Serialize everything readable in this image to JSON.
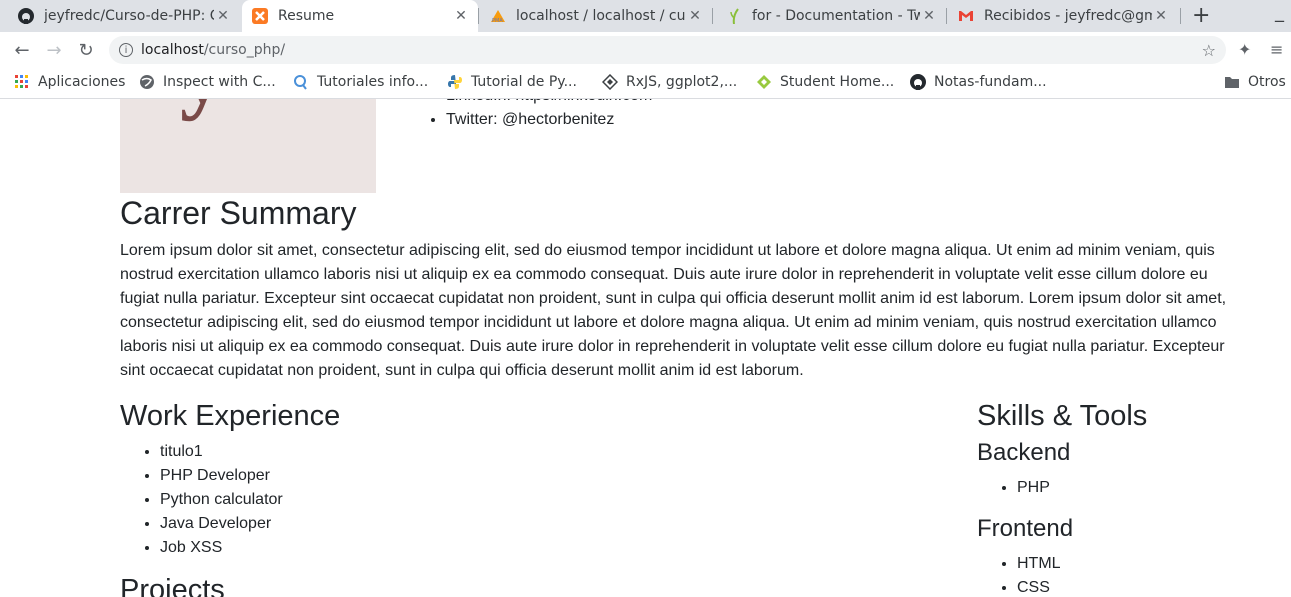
{
  "browser": {
    "tabs": [
      {
        "title": "jeyfredc/Curso-de-PHP: C",
        "icon": "github-icon",
        "active": false
      },
      {
        "title": "Resume",
        "icon": "xampp-icon",
        "active": true
      },
      {
        "title": "localhost / localhost / cur",
        "icon": "phpmyadmin-icon",
        "active": false
      },
      {
        "title": "for - Documentation - Tw",
        "icon": "twig-icon",
        "active": false
      },
      {
        "title": "Recibidos - jeyfredc@gm",
        "icon": "gmail-icon",
        "active": false
      }
    ],
    "url": {
      "host": "localhost",
      "path": "/curso_php/"
    },
    "bookmarks": [
      {
        "label": "Aplicaciones",
        "icon": "apps-grid-icon"
      },
      {
        "label": "Inspect with C...",
        "icon": "globe-icon"
      },
      {
        "label": "Tutoriales info...",
        "icon": "search-bubble-icon"
      },
      {
        "label": "Tutorial de Py...",
        "icon": "python-icon"
      },
      {
        "label": "RxJS, ggplot2,...",
        "icon": "diamond-icon"
      },
      {
        "label": "Student Home...",
        "icon": "platzi-icon"
      },
      {
        "label": "Notas-fundam...",
        "icon": "github-icon"
      }
    ],
    "other_bookmarks": "Otros"
  },
  "page": {
    "contacts": [
      "LinkedIn: https://linkedin.com",
      "Twitter: @hectorbenitez"
    ],
    "summary_title": "Carrer Summary",
    "summary_text": "Lorem ipsum dolor sit amet, consectetur adipiscing elit, sed do eiusmod tempor incididunt ut labore et dolore magna aliqua. Ut enim ad minim veniam, quis nostrud exercitation ullamco laboris nisi ut aliquip ex ea commodo consequat. Duis aute irure dolor in reprehenderit in voluptate velit esse cillum dolore eu fugiat nulla pariatur. Excepteur sint occaecat cupidatat non proident, sunt in culpa qui officia deserunt mollit anim id est laborum. Lorem ipsum dolor sit amet, consectetur adipiscing elit, sed do eiusmod tempor incididunt ut labore et dolore magna aliqua. Ut enim ad minim veniam, quis nostrud exercitation ullamco laboris nisi ut aliquip ex ea commodo consequat. Duis aute irure dolor in reprehenderit in voluptate velit esse cillum dolore eu fugiat nulla pariatur. Excepteur sint occaecat cupidatat non proident, sunt in culpa qui officia deserunt mollit anim id est laborum.",
    "work_title": "Work Experience",
    "jobs": [
      "titulo1",
      "PHP Developer",
      "Python calculator",
      "Java Developer",
      "Job XSS"
    ],
    "projects_title": "Projects",
    "skills_title": "Skills & Tools",
    "backend_title": "Backend",
    "backend": [
      "PHP"
    ],
    "frontend_title": "Frontend",
    "frontend": [
      "HTML",
      "CSS"
    ]
  }
}
